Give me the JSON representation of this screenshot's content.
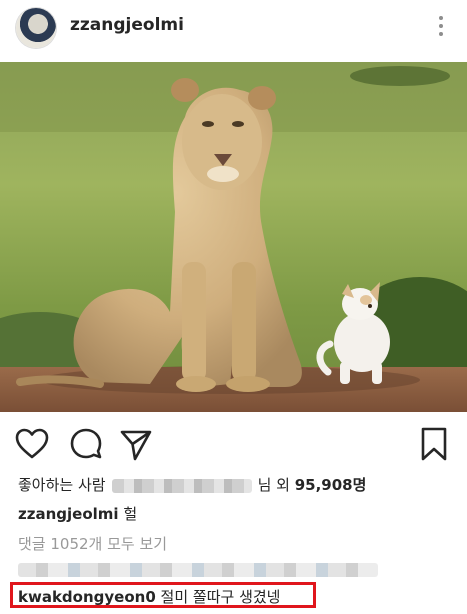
{
  "header": {
    "username": "zzangjeolmi",
    "more_icon": "three-dots-vertical-icon"
  },
  "actions": {
    "like_icon": "heart-icon",
    "comment_icon": "comment-bubble-icon",
    "share_icon": "paper-plane-icon",
    "save_icon": "bookmark-icon"
  },
  "likes": {
    "prefix": "좋아하는 사람",
    "middle": "님 외",
    "count": "95,908명"
  },
  "caption": {
    "username": "zzangjeolmi",
    "text": "헐"
  },
  "comments_link": "댓글 1052개 모두 보기",
  "highlighted_comment": {
    "username": "kwakdongyeon0",
    "text": "절미 쫄따구 생겼넹"
  },
  "colors": {
    "highlight_border": "#e0161c",
    "text_primary": "#262626",
    "text_secondary": "#999999"
  }
}
